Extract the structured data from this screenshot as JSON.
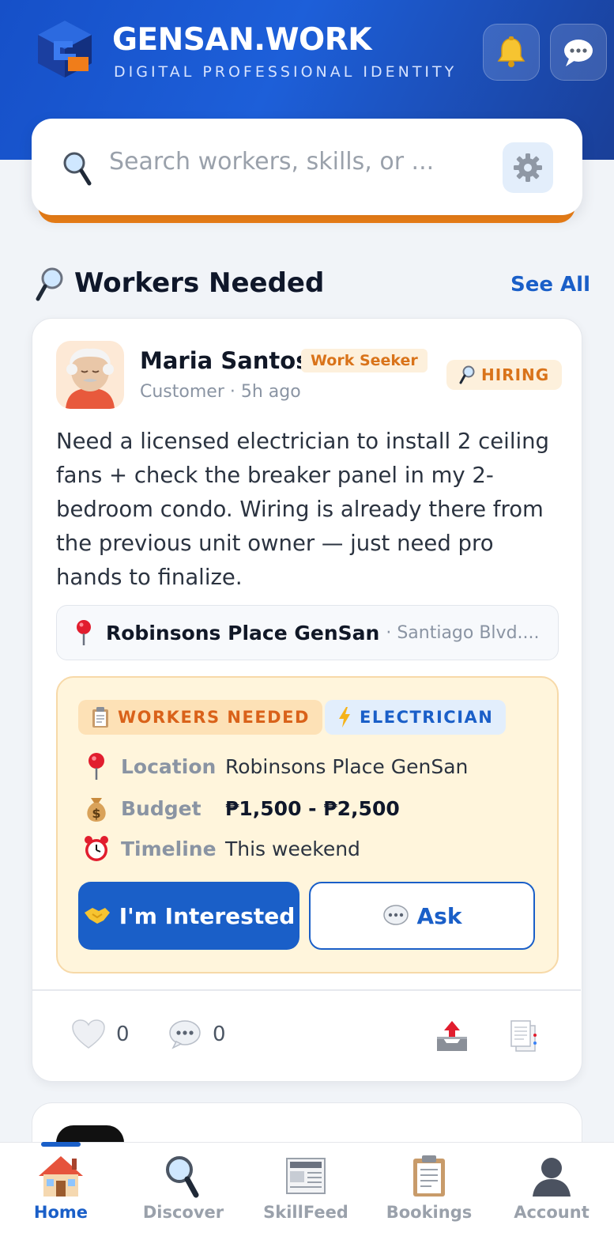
{
  "header": {
    "brand": "GENSAN.WORK",
    "tagline": "DIGITAL PROFESSIONAL IDENTITY",
    "notifications_icon": "bell-icon",
    "messages_icon": "chat-bubble-icon"
  },
  "search": {
    "placeholder": "Search workers, skills, or ...",
    "filter_icon": "gear-icon"
  },
  "section": {
    "title": "Workers Needed",
    "see_all": "See All"
  },
  "post": {
    "author": "Maria Santos",
    "author_badge": "Work Seeker",
    "meta": "Customer · 5h ago",
    "status_badge": "HIRING",
    "body": "Need a licensed electrician to install 2 ceiling fans + check the breaker panel in my 2-bedroom condo. Wiring is already there from the previous unit owner — just need pro hands to finalize.",
    "location_name": "Robinsons Place GenSan",
    "location_address": "· Santiago Blvd....",
    "job": {
      "tag_type": "WORKERS NEEDED",
      "tag_skill": "ELECTRICIAN",
      "location_label": "Location",
      "location_value": "Robinsons Place GenSan",
      "budget_label": "Budget",
      "budget_value": "₱1,500 - ₱2,500",
      "timeline_label": "Timeline",
      "timeline_value": "This weekend",
      "interested_label": "I'm Interested",
      "ask_label": "Ask"
    },
    "likes": "0",
    "comments": "0"
  },
  "nav": {
    "items": [
      {
        "label": "Home",
        "icon": "house-icon",
        "active": true
      },
      {
        "label": "Discover",
        "icon": "magnifier-icon"
      },
      {
        "label": "SkillFeed",
        "icon": "newspaper-icon"
      },
      {
        "label": "Bookings",
        "icon": "clipboard-icon"
      },
      {
        "label": "Account",
        "icon": "user-silhouette-icon"
      }
    ]
  },
  "colors": {
    "primary": "#1a5fc8",
    "accent_orange": "#ec7f16",
    "header_gradient_start": "#1650c8",
    "header_gradient_end": "#1a3f98",
    "job_box_bg": "#fff5dc"
  }
}
